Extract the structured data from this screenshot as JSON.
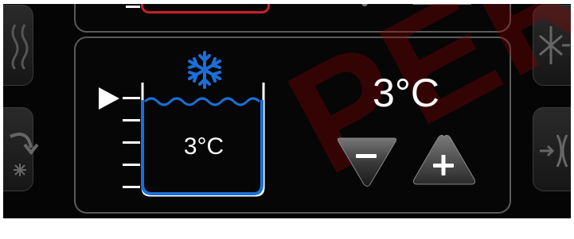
{
  "tank": {
    "mode_icon": "snowflake-icon",
    "indicator_icon": "play-arrow-icon",
    "temperature": "3°C",
    "level_ticks": 5
  },
  "setpoint": {
    "temperature": "3°C"
  },
  "controls": {
    "decrease_icon": "minus-icon",
    "increase_icon": "plus-icon"
  },
  "side_buttons": {
    "left_top_icon": "heat-waves-icon",
    "left_bottom_icon": "cool-down-arrow-icon",
    "right_top_icon": "snowflake-arrow-icon",
    "right_bottom_icon": "inflow-icon"
  },
  "watermark": "PER",
  "colors": {
    "accent_blue": "#1a6fd8",
    "alert_red": "#c8202a",
    "panel_border": "#5a5a5a"
  }
}
